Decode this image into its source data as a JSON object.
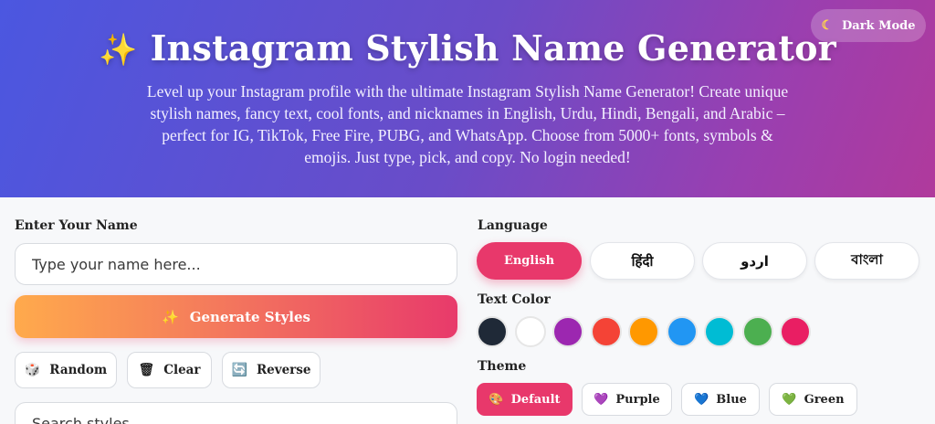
{
  "header": {
    "title": "Instagram Stylish Name Generator",
    "title_icon": "sparkles-icon",
    "description": "Level up your Instagram profile with the ultimate Instagram Stylish Name Generator! Create unique stylish names, fancy text, cool fonts, and nicknames in English, Urdu, Hindi, Bengali, and Arabic – perfect for IG, TikTok, Free Fire, PUBG, and WhatsApp. Choose from 5000+ fonts, symbols & emojis. Just type, pick, and copy. No login needed!",
    "dark_mode_label": "Dark Mode",
    "dark_mode_icon": "moon-icon"
  },
  "input_section": {
    "label": "Enter Your Name",
    "placeholder": "Type your name here...",
    "generate_label": "Generate Styles",
    "random_label": "Random",
    "clear_label": "Clear",
    "reverse_label": "Reverse",
    "search_placeholder": "Search styles..."
  },
  "language": {
    "label": "Language",
    "options": [
      "English",
      "हिंदी",
      "اردو",
      "বাংলা"
    ],
    "selected": "English"
  },
  "text_color": {
    "label": "Text Color",
    "swatches": [
      "#1f2937",
      "#ffffff",
      "#9c27b0",
      "#f44336",
      "#ff9800",
      "#2196f3",
      "#00bcd4",
      "#4caf50",
      "#e91e63"
    ]
  },
  "theme": {
    "label": "Theme",
    "options": [
      {
        "label": "Default",
        "icon": "palette-icon"
      },
      {
        "label": "Purple",
        "icon": "purple-heart-icon"
      },
      {
        "label": "Blue",
        "icon": "blue-heart-icon"
      },
      {
        "label": "Green",
        "icon": "green-heart-icon"
      }
    ],
    "selected": "Default"
  },
  "colors": {
    "accent": "#e8386b",
    "hero_start": "#4b57e0",
    "hero_end": "#b03a9c"
  }
}
